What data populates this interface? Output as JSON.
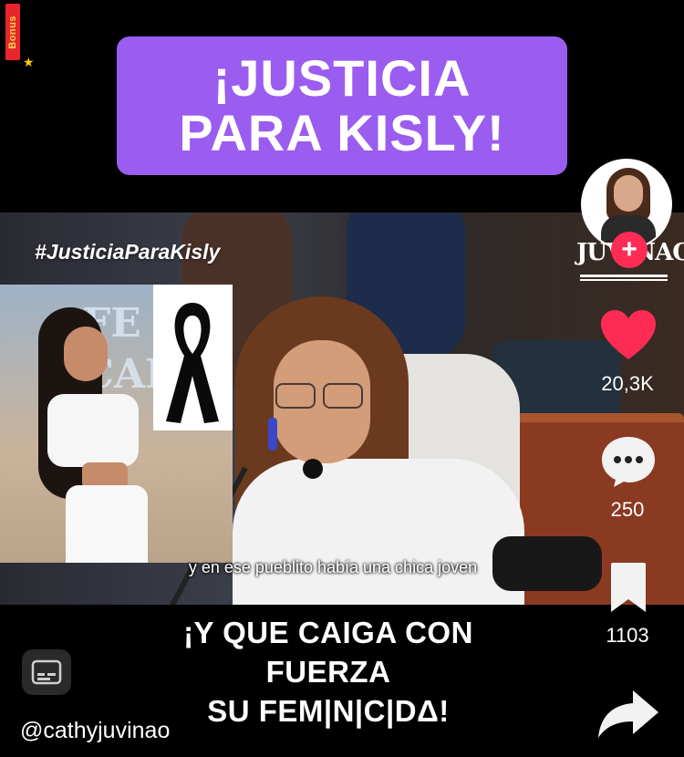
{
  "badge": {
    "label": "Bonus"
  },
  "headline": {
    "line1": "¡JUSTICIA",
    "line2": "PARA KISLY!"
  },
  "video": {
    "hashtag": "#JusticiaParaKisly",
    "subtitle": "y en ese pueblito había una chica joven",
    "inset_sign": "FE CAP"
  },
  "caption": {
    "line1": "¡Y QUE CAIGA CON",
    "line2": "FUERZA",
    "line3": "SU FEM|N|C|DΔ!"
  },
  "author": {
    "username": "@cathyjuvinao",
    "brand": "JUVINAO"
  },
  "actions": {
    "likes": "20,3K",
    "comments": "250",
    "saves": "1103"
  },
  "colors": {
    "headline_bg": "#9b5cf0",
    "like": "#fe2c55",
    "follow": "#fe2c55"
  }
}
